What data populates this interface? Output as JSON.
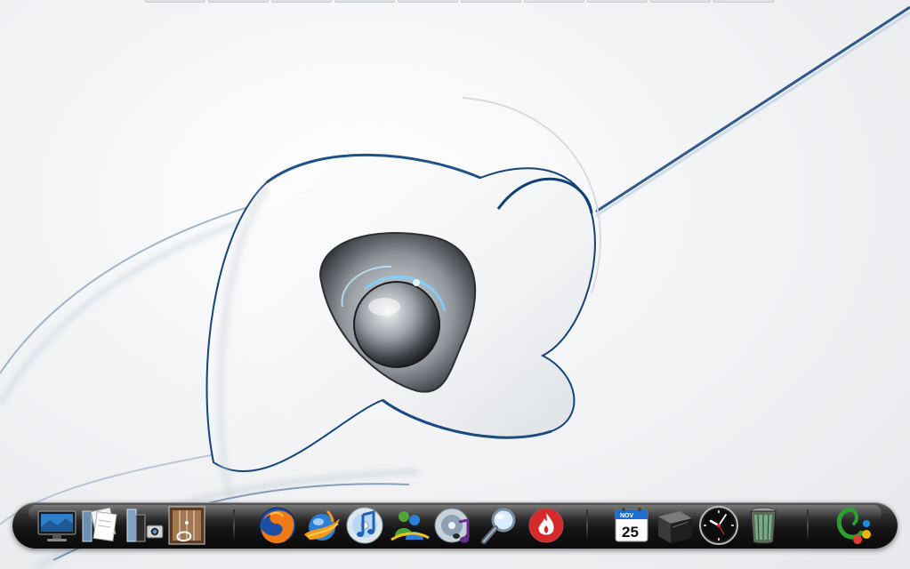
{
  "top_strip": {
    "tab_count": 10
  },
  "dock": {
    "items": [
      {
        "id": "desktop-display",
        "icon": "monitor-icon"
      },
      {
        "id": "documents",
        "icon": "documents-stack-icon"
      },
      {
        "id": "applications",
        "icon": "phone-camera-icon"
      },
      {
        "id": "media",
        "icon": "media-player-icon"
      },
      {
        "id": "firefox",
        "icon": "firefox-icon"
      },
      {
        "id": "browser",
        "icon": "fire-orb-browser-icon"
      },
      {
        "id": "itunes",
        "icon": "music-note-cd-icon"
      },
      {
        "id": "messenger",
        "icon": "messenger-people-icon"
      },
      {
        "id": "music-disc",
        "icon": "music-disc-icon"
      },
      {
        "id": "search",
        "icon": "magnifier-icon"
      },
      {
        "id": "burner",
        "icon": "flame-icon"
      },
      {
        "id": "calendar",
        "icon": "calendar-icon"
      },
      {
        "id": "stack",
        "icon": "dark-box-icon"
      },
      {
        "id": "clock",
        "icon": "clock-icon"
      },
      {
        "id": "trash",
        "icon": "trash-bin-icon"
      },
      {
        "id": "launcher",
        "icon": "colorful-logo-icon"
      }
    ],
    "calendar": {
      "month": "NOV",
      "day": "25"
    }
  },
  "colors": {
    "wallpaper_blue": "#0e3f7a",
    "dock_dark": "#141414",
    "firefox_orange": "#f07a14",
    "firefox_blue": "#1c4ea3",
    "calendar_red": "#1e6ecf",
    "launcher_green": "#2aa12e"
  }
}
